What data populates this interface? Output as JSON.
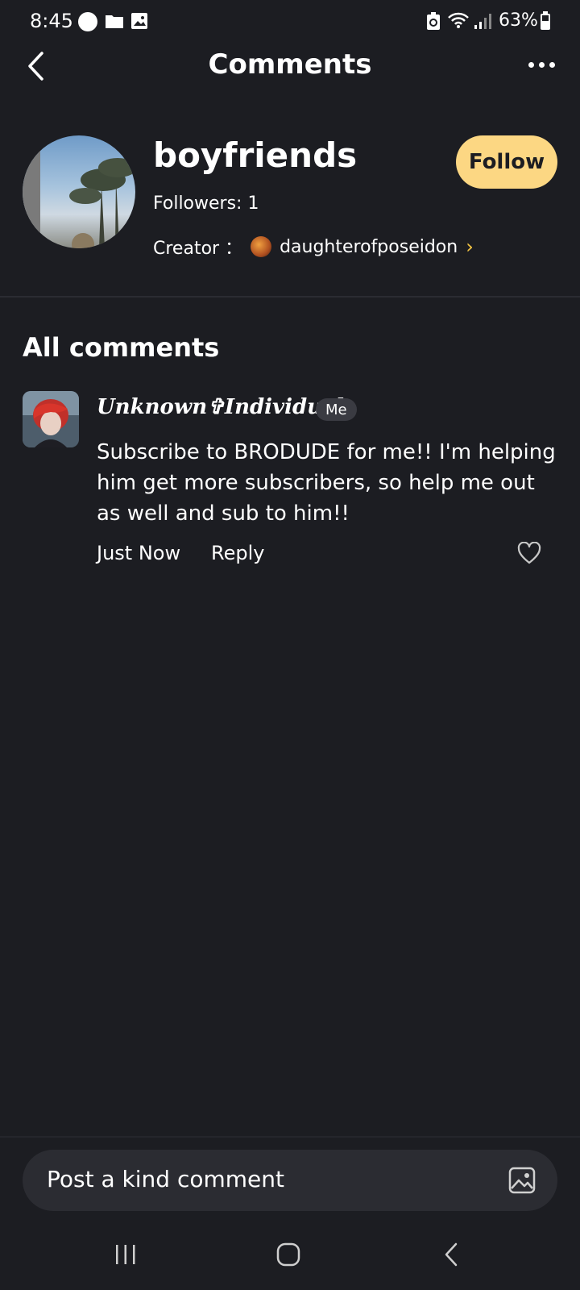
{
  "status_bar": {
    "time": "8:45",
    "battery": "63%",
    "icons": [
      "circle-icon",
      "folder-icon",
      "image-icon",
      "recycle-icon",
      "wifi-icon",
      "signal-icon",
      "battery-icon"
    ]
  },
  "header": {
    "title": "Comments",
    "back_icon": "chevron-left-icon",
    "more_icon": "more-dots-icon"
  },
  "story": {
    "title": "boyfriends",
    "followers": "Followers: 1",
    "creator_label": "Creator ：",
    "creator_name": "daughterofposeidon",
    "creator_chevron": "›",
    "follow_label": "Follow"
  },
  "section": {
    "title": "All comments"
  },
  "comments": [
    {
      "author": "Unknown✞Individual",
      "badge": "Me",
      "text": "Subscribe to BRODUDE for me!! I'm helping him get more subscribers, so help me out as well and sub to him!!",
      "time": "Just Now",
      "reply_label": "Reply",
      "like_icon": "heart-outline-icon"
    }
  ],
  "composer": {
    "placeholder": "Post a kind comment",
    "image_icon": "image-upload-icon"
  },
  "nav_bar": {
    "icons": [
      "recent-apps-icon",
      "home-icon",
      "back-icon"
    ]
  },
  "colors": {
    "background": "#1c1d22",
    "follow_button": "#fcd783",
    "accent_chevron": "#f5c542",
    "input_background": "#2b2c32"
  }
}
